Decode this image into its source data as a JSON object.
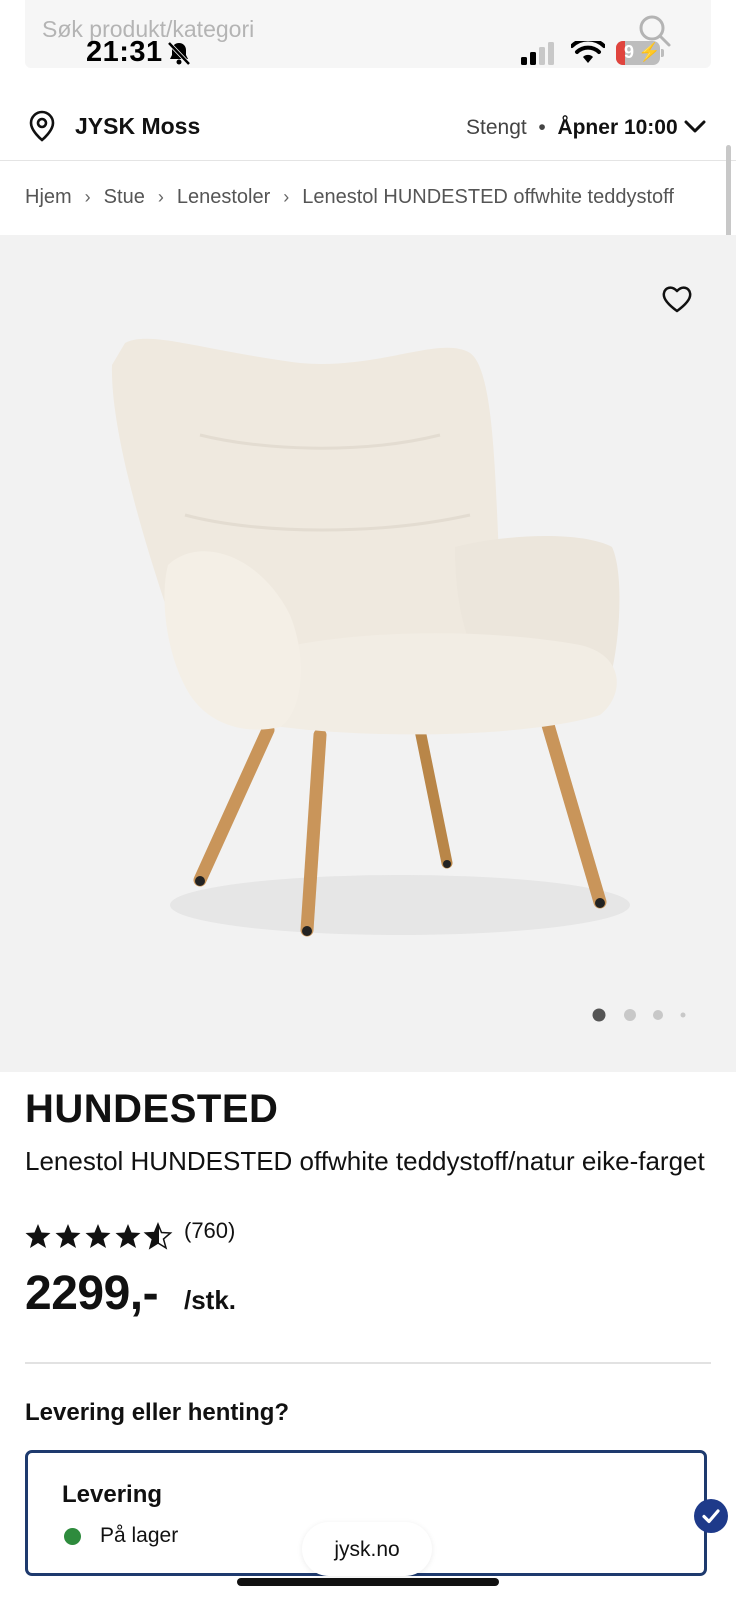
{
  "search": {
    "placeholder": "Søk produkt/kategori"
  },
  "status_bar": {
    "time": "21:31",
    "battery": "9"
  },
  "store": {
    "name": "JYSK Moss",
    "status": "Stengt",
    "opens": "Åpner 10:00"
  },
  "breadcrumb": [
    "Hjem",
    "Stue",
    "Lenestoler",
    "Lenestol HUNDESTED offwhite teddystoff"
  ],
  "product": {
    "brand": "HUNDESTED",
    "name": "Lenestol HUNDESTED offwhite teddystoff/natur eike-farget",
    "rating": 4.5,
    "rating_count": "(760)",
    "price": "2299,-",
    "unit": "/stk."
  },
  "gallery": {
    "image_count": 4,
    "active_index": 0
  },
  "delivery": {
    "heading": "Levering eller henting?",
    "option_title": "Levering",
    "stock_status": "På lager"
  },
  "browser": {
    "url": "jysk.no"
  },
  "colors": {
    "accent_navy": "#1e3a6e",
    "in_stock_green": "#2e8b3d",
    "image_bg": "#f2f2f2"
  }
}
